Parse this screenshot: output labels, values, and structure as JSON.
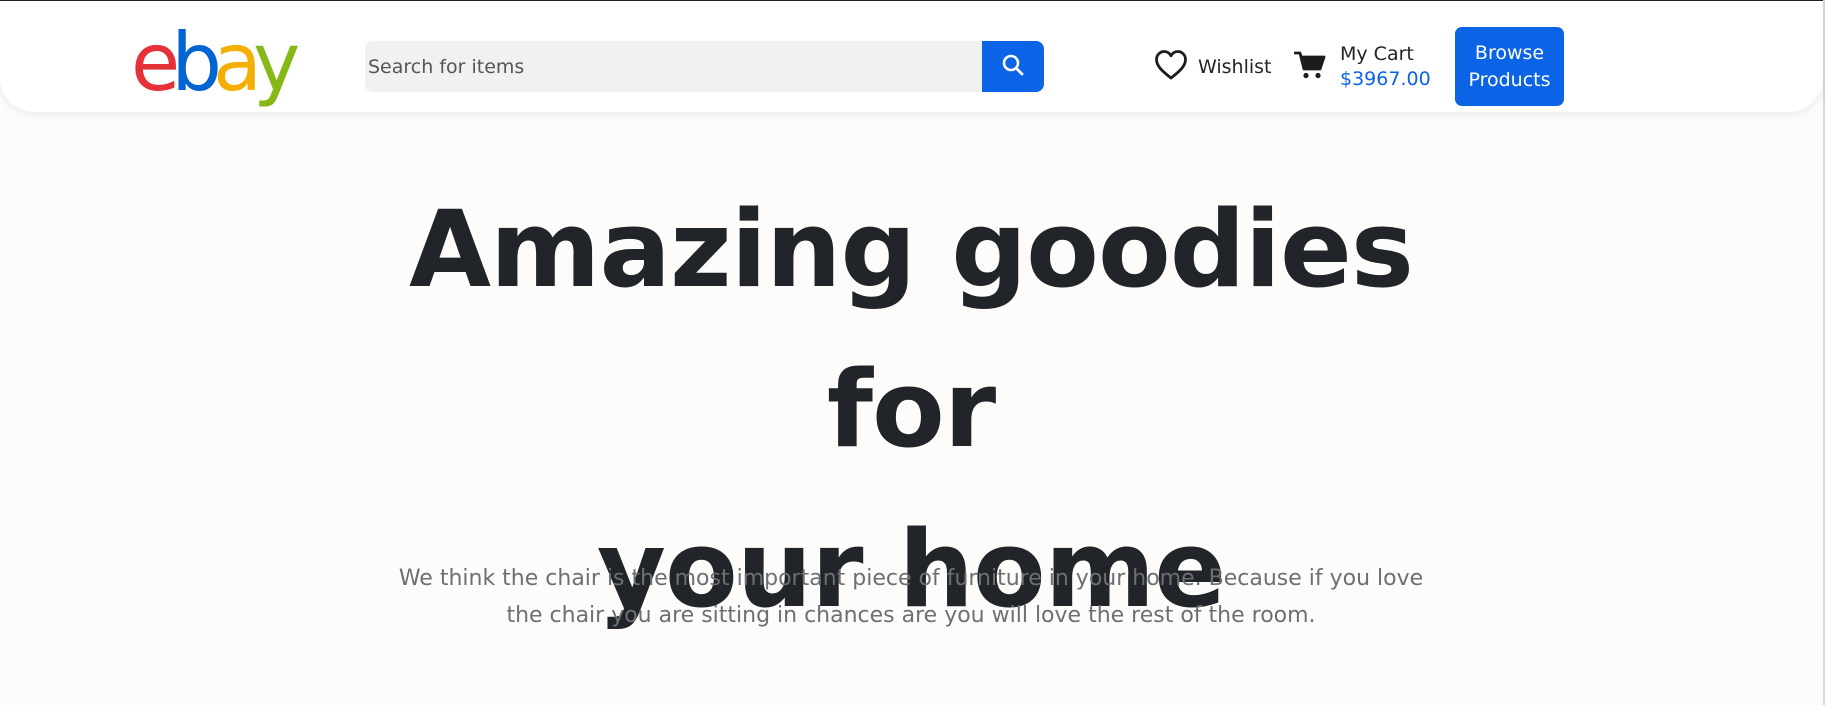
{
  "header": {
    "logo": {
      "letters": [
        "e",
        "b",
        "a",
        "y"
      ],
      "colors": [
        "#e53238",
        "#0064d2",
        "#f5af02",
        "#86b817"
      ]
    },
    "search": {
      "placeholder": "Search for items",
      "value": "",
      "icon": "search-icon"
    },
    "wishlist": {
      "label": "Wishlist",
      "icon": "heart-icon"
    },
    "cart": {
      "label": "My Cart",
      "total": "$3967.00",
      "icon": "cart-icon"
    },
    "browse_button": {
      "line1": "Browse",
      "line2": "Products"
    },
    "accent_color": "#0b63e5"
  },
  "hero": {
    "title_line1": "Amazing goodies for",
    "title_line2": "your home",
    "description_line1": "We think the chair is the most important piece of furniture in your home. Because if you love",
    "description_line2": "the chair you are sitting in chances are you will love the rest of the room."
  }
}
